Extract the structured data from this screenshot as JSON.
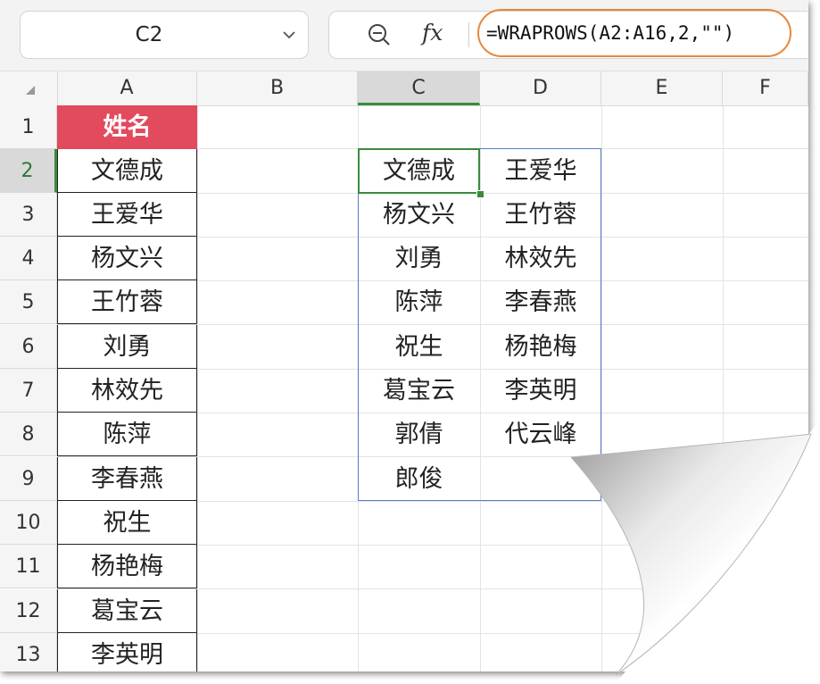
{
  "formula_bar": {
    "cell_ref": "C2",
    "formula": "=WRAPROWS(A2:A16,2,\"\")"
  },
  "columns": [
    "A",
    "B",
    "C",
    "D",
    "E",
    "F"
  ],
  "rows": [
    "1",
    "2",
    "3",
    "4",
    "5",
    "6",
    "7",
    "8",
    "9",
    "10",
    "11",
    "12",
    "13"
  ],
  "column_a": {
    "header": "姓名",
    "names": [
      "文德成",
      "王爱华",
      "杨文兴",
      "王竹蓉",
      "刘勇",
      "林效先",
      "陈萍",
      "李春燕",
      "祝生",
      "杨艳梅",
      "葛宝云",
      "李英明"
    ]
  },
  "result": {
    "col_c": [
      "文德成",
      "杨文兴",
      "刘勇",
      "陈萍",
      "祝生",
      "葛宝云",
      "郭倩",
      "郎俊"
    ],
    "col_d": [
      "王爱华",
      "王竹蓉",
      "林效先",
      "李春燕",
      "杨艳梅",
      "李英明",
      "代云峰",
      ""
    ]
  },
  "colors": {
    "header_fill": "#e24a5e",
    "selection": "#3a8a3e",
    "spill_border": "#4f7fc8",
    "formula_outline": "#e8873a"
  }
}
